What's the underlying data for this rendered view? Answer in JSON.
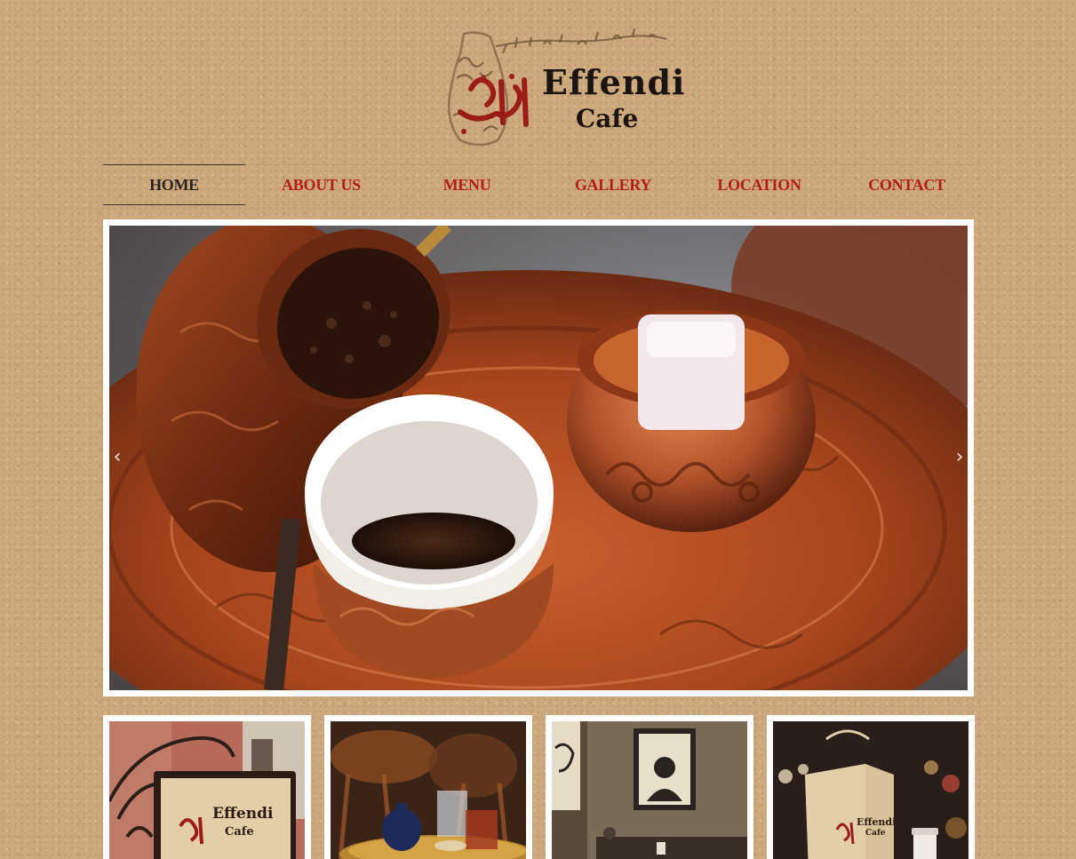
{
  "brand": {
    "name": "Effendi",
    "subtitle": "Cafe",
    "arabic_name": "أفندي",
    "colors": {
      "accent": "#b21e1a",
      "active": "#2a2220",
      "background": "#cda87d"
    }
  },
  "nav": {
    "items": [
      {
        "label": "HOME",
        "active": true
      },
      {
        "label": "ABOUT US",
        "active": false
      },
      {
        "label": "MENU",
        "active": false
      },
      {
        "label": "GALLERY",
        "active": false
      },
      {
        "label": "LOCATION",
        "active": false
      },
      {
        "label": "CONTACT",
        "active": false
      }
    ]
  },
  "hero": {
    "prev_icon": "chevron-left-icon",
    "next_icon": "chevron-right-icon",
    "prev_glyph": "‹",
    "next_glyph": "›"
  },
  "thumbnails": [
    {
      "sign_name": "Effendi",
      "sign_sub": "Cafe"
    },
    {},
    {},
    {
      "bag_name": "Effendi",
      "bag_sub": "Cafe"
    }
  ]
}
